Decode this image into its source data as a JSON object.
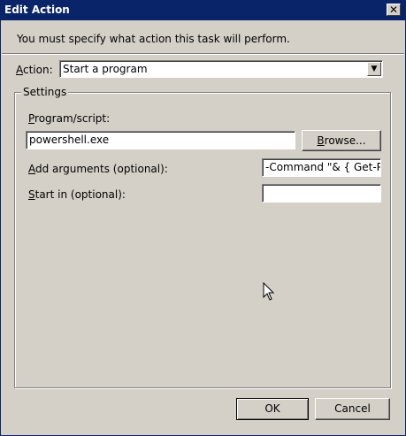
{
  "window": {
    "title": "Edit Action",
    "close_glyph": "✕"
  },
  "header": {
    "instruction": "You must specify what action this task will perform."
  },
  "action": {
    "label_mnemonic": "A",
    "label_rest": "ction:",
    "selected": "Start a program",
    "arrow_glyph": "▼"
  },
  "settings": {
    "group_label": "Settings",
    "program_label_mnemonic": "P",
    "program_label_rest": "rogram/script:",
    "program_value": "powershell.exe",
    "browse_label_mnemonic": "B",
    "browse_label_rest": "rowse...",
    "args_label_mnemonic": "A",
    "args_label_rest": "dd arguments (optional):",
    "args_value": "-Command \"& { Get-Pro",
    "start_label_mnemonic": "S",
    "start_label_rest": "tart in (optional):",
    "start_value": ""
  },
  "buttons": {
    "ok_label": "OK",
    "cancel_label": "Cancel"
  },
  "icons": {
    "cursor": "mouse-pointer-icon"
  },
  "colors": {
    "titlebar": "#0a246a",
    "face": "#d4d0c8",
    "field": "#ffffff"
  }
}
